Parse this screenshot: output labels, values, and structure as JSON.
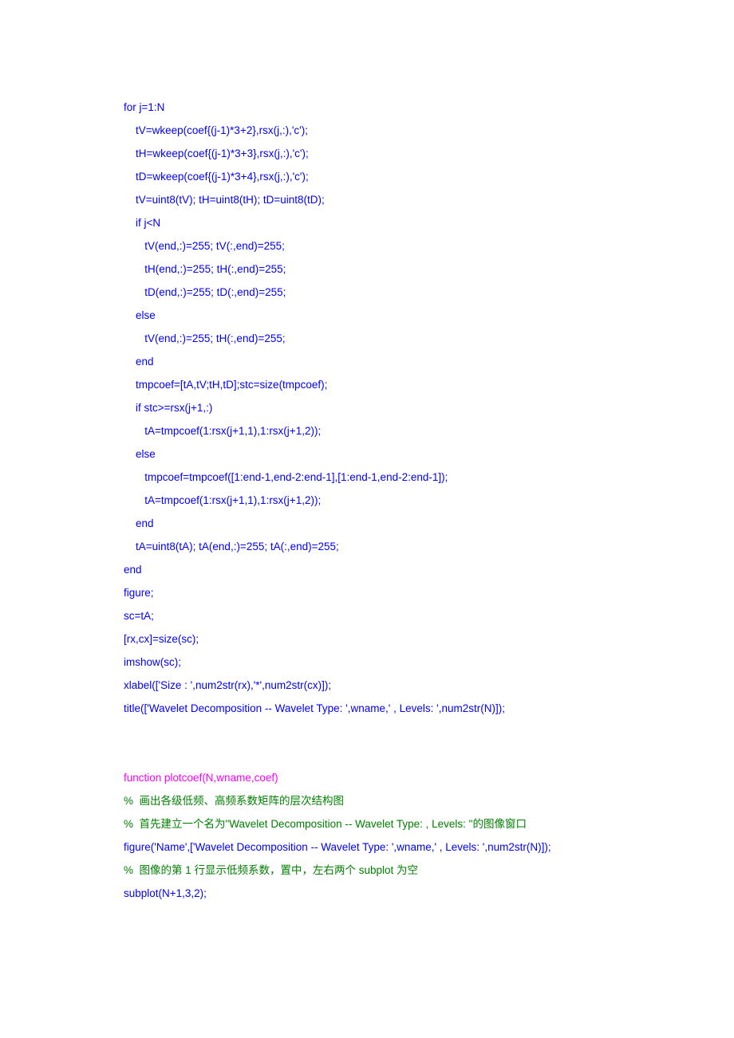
{
  "code": {
    "l1": "for j=1:N",
    "l2": "    tV=wkeep(coef{(j-1)*3+2},rsx(j,:),'c');",
    "l3": "    tH=wkeep(coef{(j-1)*3+3},rsx(j,:),'c');",
    "l4": "    tD=wkeep(coef{(j-1)*3+4},rsx(j,:),'c');",
    "l5": "    tV=uint8(tV); tH=uint8(tH); tD=uint8(tD);",
    "l6": "    if j<N",
    "l7": "       tV(end,:)=255; tV(:,end)=255;",
    "l8": "       tH(end,:)=255; tH(:,end)=255;",
    "l9": "       tD(end,:)=255; tD(:,end)=255;",
    "l10": "    else",
    "l11": "       tV(end,:)=255; tH(:,end)=255;",
    "l12": "    end",
    "l13": "    tmpcoef=[tA,tV;tH,tD];stc=size(tmpcoef);",
    "l14": "    if stc>=rsx(j+1,:)",
    "l15": "       tA=tmpcoef(1:rsx(j+1,1),1:rsx(j+1,2));",
    "l16": "    else",
    "l17": "       tmpcoef=tmpcoef([1:end-1,end-2:end-1],[1:end-1,end-2:end-1]);",
    "l18": "       tA=tmpcoef(1:rsx(j+1,1),1:rsx(j+1,2));",
    "l19": "    end",
    "l20": "    tA=uint8(tA); tA(end,:)=255; tA(:,end)=255;",
    "l21": "end",
    "l22": "figure;",
    "l23": "sc=tA;",
    "l24": "[rx,cx]=size(sc);",
    "l25": "imshow(sc);",
    "l26": "xlabel(['Size : ',num2str(rx),'*',num2str(cx)]);",
    "l27": "title(['Wavelet Decomposition -- Wavelet Type: ',wname,' , Levels: ',num2str(N)]);",
    "l28": "function plotcoef(N,wname,coef)",
    "l29": "%  画出各级低频、高频系数矩阵的层次结构图",
    "l30": "%  首先建立一个名为\"Wavelet Decomposition -- Wavelet Type: , Levels: \"的图像窗口",
    "l31": "figure('Name',['Wavelet Decomposition -- Wavelet Type: ',wname,' , Levels: ',num2str(N)]);",
    "l32": "%  图像的第 1 行显示低频系数，置中，左右两个 subplot 为空",
    "l33": "subplot(N+1,3,2);"
  }
}
